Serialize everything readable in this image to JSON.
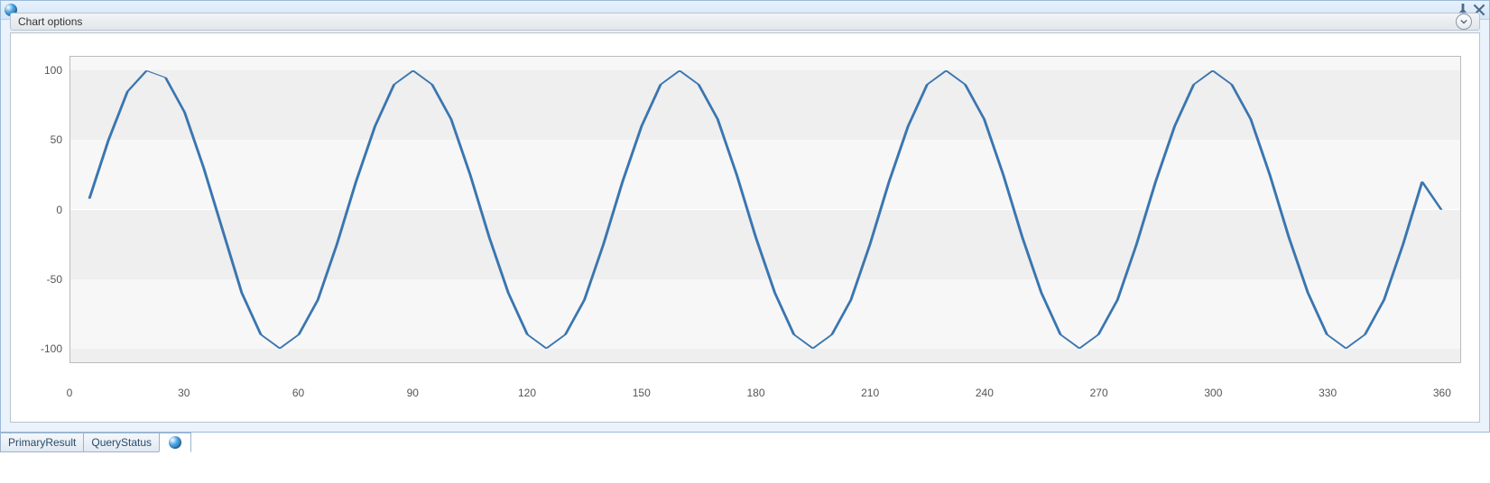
{
  "panel": {
    "chart_options_label": "Chart options"
  },
  "tabs": {
    "primary": "PrimaryResult",
    "status": "QueryStatus"
  },
  "chart_data": {
    "type": "line",
    "x": [
      5,
      10,
      15,
      20,
      25,
      30,
      35,
      40,
      45,
      50,
      55,
      60,
      65,
      70,
      75,
      80,
      85,
      90,
      95,
      100,
      105,
      110,
      115,
      120,
      125,
      130,
      135,
      140,
      145,
      150,
      155,
      160,
      165,
      170,
      175,
      180,
      185,
      190,
      195,
      200,
      205,
      210,
      215,
      220,
      225,
      230,
      235,
      240,
      245,
      250,
      255,
      260,
      265,
      270,
      275,
      280,
      285,
      290,
      295,
      300,
      305,
      310,
      315,
      320,
      325,
      330,
      335,
      340,
      345,
      350,
      355,
      360
    ],
    "values": [
      8,
      50,
      85,
      100,
      95,
      70,
      30,
      -15,
      -60,
      -90,
      -100,
      -90,
      -65,
      -25,
      20,
      60,
      90,
      100,
      90,
      65,
      25,
      -20,
      -60,
      -90,
      -100,
      -90,
      -65,
      -25,
      20,
      60,
      90,
      100,
      90,
      65,
      25,
      -20,
      -60,
      -90,
      -100,
      -90,
      -65,
      -25,
      20,
      60,
      90,
      100,
      90,
      65,
      25,
      -20,
      -60,
      -90,
      -100,
      -90,
      -65,
      -25,
      20,
      60,
      90,
      100,
      90,
      65,
      25,
      -20,
      -60,
      -90,
      -100,
      -90,
      -65,
      -25,
      20,
      0
    ],
    "x_ticks": [
      0,
      30,
      60,
      90,
      120,
      150,
      180,
      210,
      240,
      270,
      300,
      330,
      360
    ],
    "y_ticks": [
      -100,
      -50,
      0,
      50,
      100
    ],
    "xlim": [
      0,
      365
    ],
    "ylim": [
      -110,
      110
    ],
    "title": "",
    "xlabel": "",
    "ylabel": "",
    "line_color": "#3a76b0"
  }
}
